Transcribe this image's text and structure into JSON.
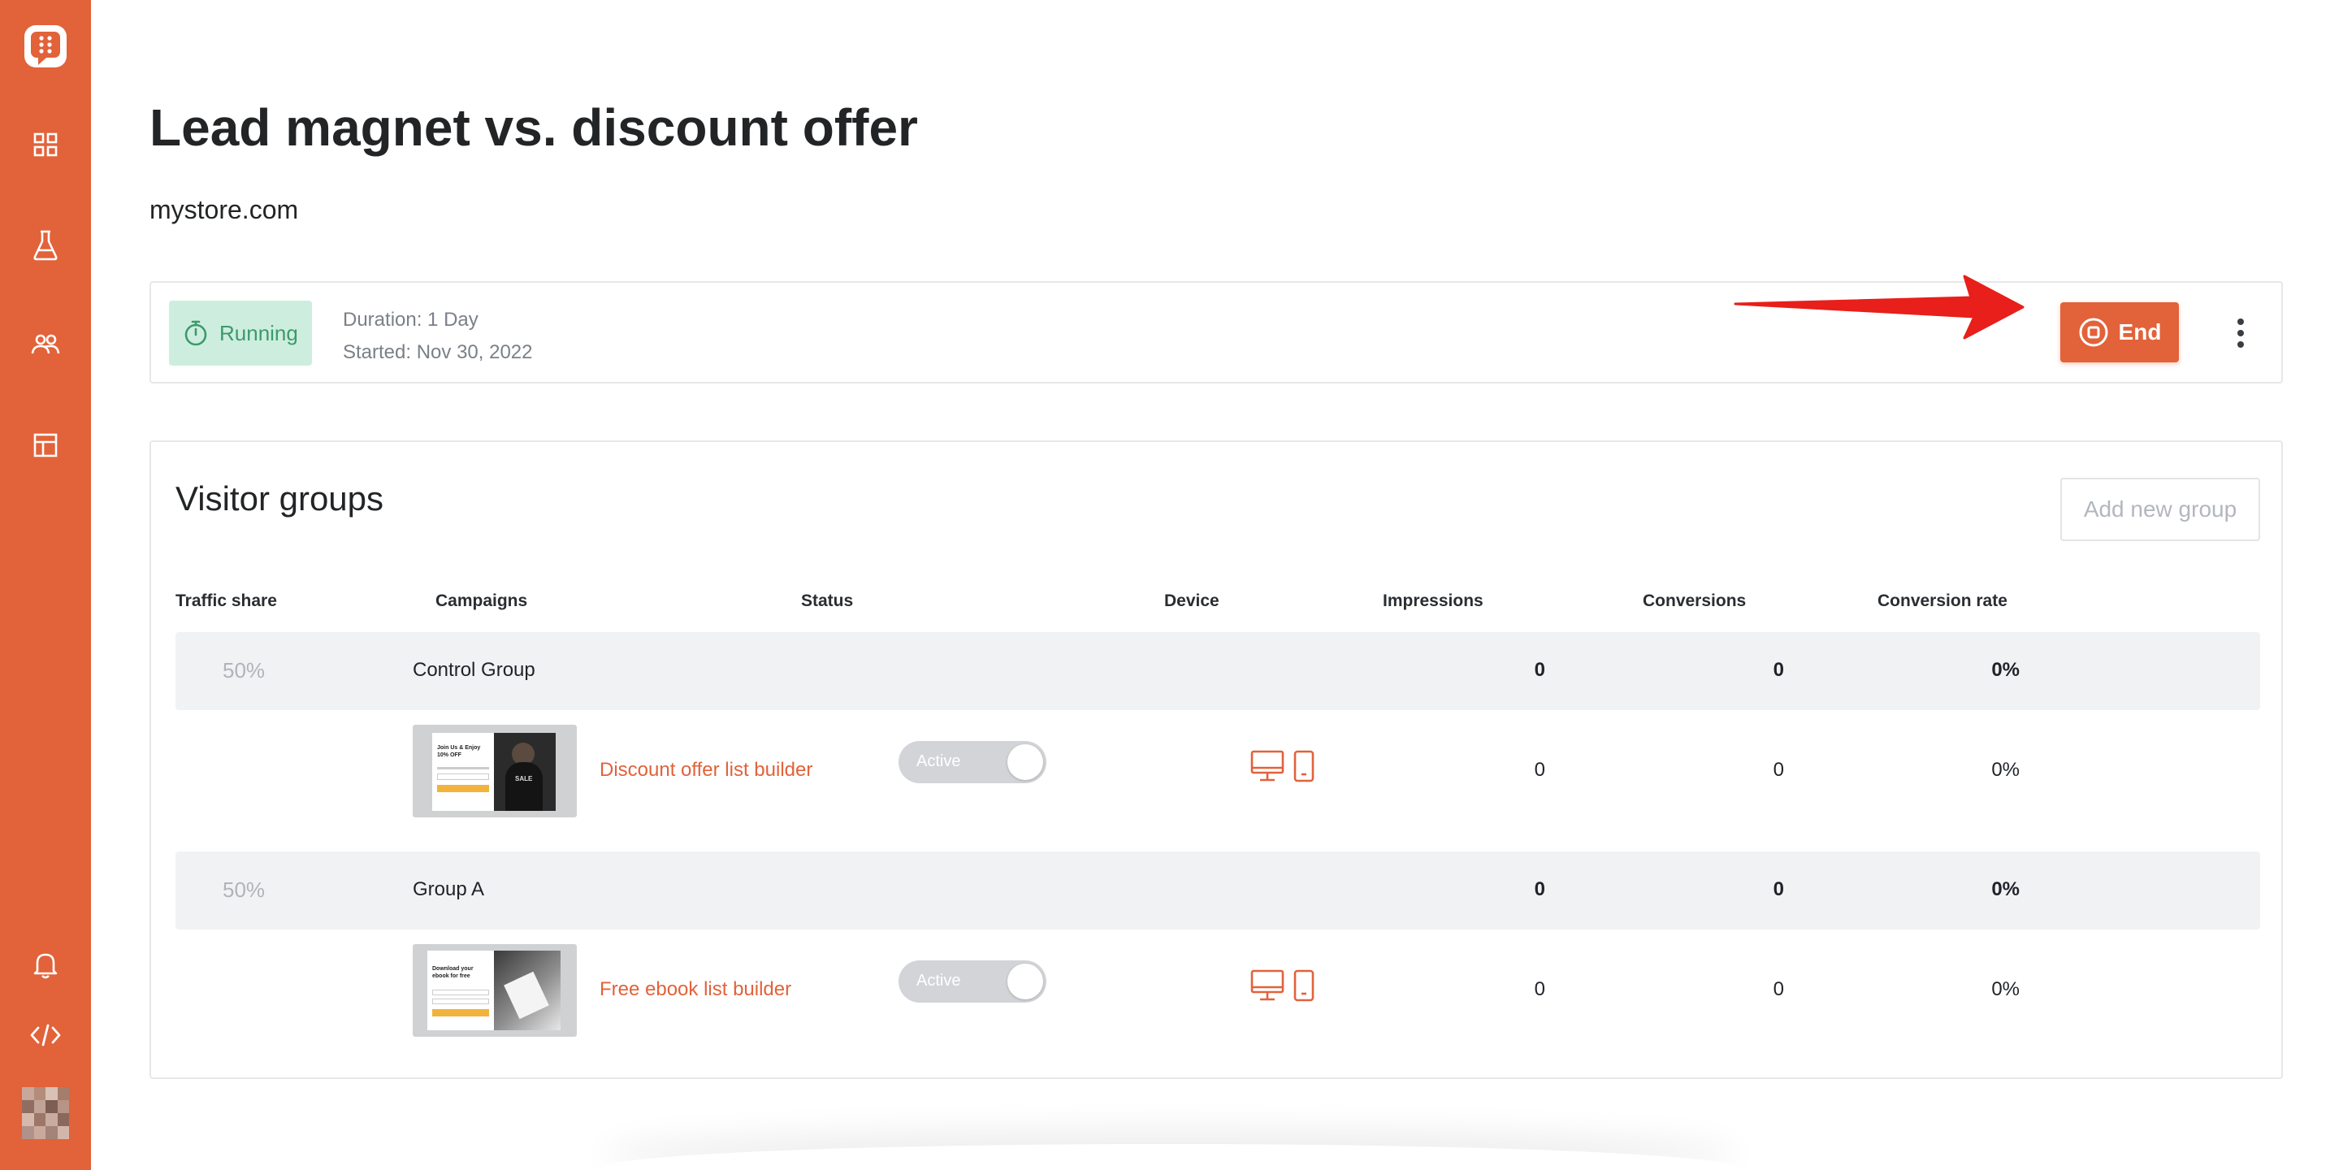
{
  "page": {
    "title": "Lead magnet vs. discount offer",
    "domain": "mystore.com"
  },
  "colors": {
    "brand": "#e2623a",
    "running_bg": "#cdeede",
    "running_text": "#3c9a6c",
    "row_bg": "#f1f2f3"
  },
  "sidebar": {
    "icons": [
      "logo-icon",
      "dashboard-icon",
      "experiments-icon",
      "audience-icon",
      "templates-icon",
      "bell-icon",
      "code-icon",
      "user-avatar"
    ]
  },
  "status": {
    "badge": "Running",
    "duration": "Duration: 1 Day",
    "started": "Started: Nov 30, 2022",
    "end_label": "End"
  },
  "visitor_groups": {
    "title": "Visitor groups",
    "add_button": "Add new group",
    "columns": [
      "Traffic share",
      "Campaigns",
      "Status",
      "Device",
      "Impressions",
      "Conversions",
      "Conversion rate"
    ],
    "groups": [
      {
        "share": "50%",
        "name": "Control Group",
        "impressions": "0",
        "conversions": "0",
        "rate": "0%",
        "campaign": {
          "name": "Discount offer list builder",
          "status": "Active",
          "impressions": "0",
          "conversions": "0",
          "rate": "0%",
          "thumb_text": "Join Us & Enjoy 10% OFF",
          "thumb_sign": "SALE"
        }
      },
      {
        "share": "50%",
        "name": "Group A",
        "impressions": "0",
        "conversions": "0",
        "rate": "0%",
        "campaign": {
          "name": "Free ebook list builder",
          "status": "Active",
          "impressions": "0",
          "conversions": "0",
          "rate": "0%",
          "thumb_text": "Download your ebook for free"
        }
      }
    ]
  }
}
